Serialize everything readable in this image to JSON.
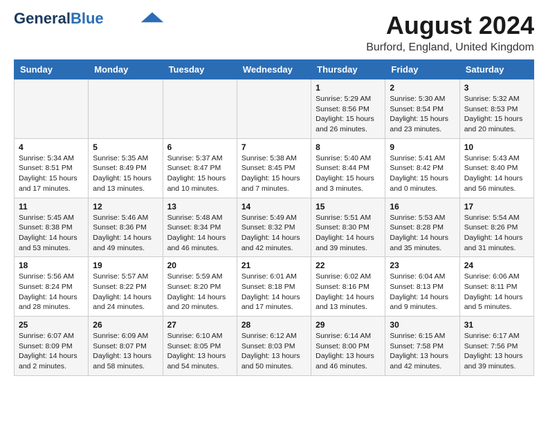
{
  "logo": {
    "part1": "General",
    "part2": "Blue"
  },
  "header": {
    "month_year": "August 2024",
    "location": "Burford, England, United Kingdom"
  },
  "days_of_week": [
    "Sunday",
    "Monday",
    "Tuesday",
    "Wednesday",
    "Thursday",
    "Friday",
    "Saturday"
  ],
  "weeks": [
    [
      {
        "day": "",
        "info": ""
      },
      {
        "day": "",
        "info": ""
      },
      {
        "day": "",
        "info": ""
      },
      {
        "day": "",
        "info": ""
      },
      {
        "day": "1",
        "info": "Sunrise: 5:29 AM\nSunset: 8:56 PM\nDaylight: 15 hours\nand 26 minutes."
      },
      {
        "day": "2",
        "info": "Sunrise: 5:30 AM\nSunset: 8:54 PM\nDaylight: 15 hours\nand 23 minutes."
      },
      {
        "day": "3",
        "info": "Sunrise: 5:32 AM\nSunset: 8:53 PM\nDaylight: 15 hours\nand 20 minutes."
      }
    ],
    [
      {
        "day": "4",
        "info": "Sunrise: 5:34 AM\nSunset: 8:51 PM\nDaylight: 15 hours\nand 17 minutes."
      },
      {
        "day": "5",
        "info": "Sunrise: 5:35 AM\nSunset: 8:49 PM\nDaylight: 15 hours\nand 13 minutes."
      },
      {
        "day": "6",
        "info": "Sunrise: 5:37 AM\nSunset: 8:47 PM\nDaylight: 15 hours\nand 10 minutes."
      },
      {
        "day": "7",
        "info": "Sunrise: 5:38 AM\nSunset: 8:45 PM\nDaylight: 15 hours\nand 7 minutes."
      },
      {
        "day": "8",
        "info": "Sunrise: 5:40 AM\nSunset: 8:44 PM\nDaylight: 15 hours\nand 3 minutes."
      },
      {
        "day": "9",
        "info": "Sunrise: 5:41 AM\nSunset: 8:42 PM\nDaylight: 15 hours\nand 0 minutes."
      },
      {
        "day": "10",
        "info": "Sunrise: 5:43 AM\nSunset: 8:40 PM\nDaylight: 14 hours\nand 56 minutes."
      }
    ],
    [
      {
        "day": "11",
        "info": "Sunrise: 5:45 AM\nSunset: 8:38 PM\nDaylight: 14 hours\nand 53 minutes."
      },
      {
        "day": "12",
        "info": "Sunrise: 5:46 AM\nSunset: 8:36 PM\nDaylight: 14 hours\nand 49 minutes."
      },
      {
        "day": "13",
        "info": "Sunrise: 5:48 AM\nSunset: 8:34 PM\nDaylight: 14 hours\nand 46 minutes."
      },
      {
        "day": "14",
        "info": "Sunrise: 5:49 AM\nSunset: 8:32 PM\nDaylight: 14 hours\nand 42 minutes."
      },
      {
        "day": "15",
        "info": "Sunrise: 5:51 AM\nSunset: 8:30 PM\nDaylight: 14 hours\nand 39 minutes."
      },
      {
        "day": "16",
        "info": "Sunrise: 5:53 AM\nSunset: 8:28 PM\nDaylight: 14 hours\nand 35 minutes."
      },
      {
        "day": "17",
        "info": "Sunrise: 5:54 AM\nSunset: 8:26 PM\nDaylight: 14 hours\nand 31 minutes."
      }
    ],
    [
      {
        "day": "18",
        "info": "Sunrise: 5:56 AM\nSunset: 8:24 PM\nDaylight: 14 hours\nand 28 minutes."
      },
      {
        "day": "19",
        "info": "Sunrise: 5:57 AM\nSunset: 8:22 PM\nDaylight: 14 hours\nand 24 minutes."
      },
      {
        "day": "20",
        "info": "Sunrise: 5:59 AM\nSunset: 8:20 PM\nDaylight: 14 hours\nand 20 minutes."
      },
      {
        "day": "21",
        "info": "Sunrise: 6:01 AM\nSunset: 8:18 PM\nDaylight: 14 hours\nand 17 minutes."
      },
      {
        "day": "22",
        "info": "Sunrise: 6:02 AM\nSunset: 8:16 PM\nDaylight: 14 hours\nand 13 minutes."
      },
      {
        "day": "23",
        "info": "Sunrise: 6:04 AM\nSunset: 8:13 PM\nDaylight: 14 hours\nand 9 minutes."
      },
      {
        "day": "24",
        "info": "Sunrise: 6:06 AM\nSunset: 8:11 PM\nDaylight: 14 hours\nand 5 minutes."
      }
    ],
    [
      {
        "day": "25",
        "info": "Sunrise: 6:07 AM\nSunset: 8:09 PM\nDaylight: 14 hours\nand 2 minutes."
      },
      {
        "day": "26",
        "info": "Sunrise: 6:09 AM\nSunset: 8:07 PM\nDaylight: 13 hours\nand 58 minutes."
      },
      {
        "day": "27",
        "info": "Sunrise: 6:10 AM\nSunset: 8:05 PM\nDaylight: 13 hours\nand 54 minutes."
      },
      {
        "day": "28",
        "info": "Sunrise: 6:12 AM\nSunset: 8:03 PM\nDaylight: 13 hours\nand 50 minutes."
      },
      {
        "day": "29",
        "info": "Sunrise: 6:14 AM\nSunset: 8:00 PM\nDaylight: 13 hours\nand 46 minutes."
      },
      {
        "day": "30",
        "info": "Sunrise: 6:15 AM\nSunset: 7:58 PM\nDaylight: 13 hours\nand 42 minutes."
      },
      {
        "day": "31",
        "info": "Sunrise: 6:17 AM\nSunset: 7:56 PM\nDaylight: 13 hours\nand 39 minutes."
      }
    ]
  ]
}
